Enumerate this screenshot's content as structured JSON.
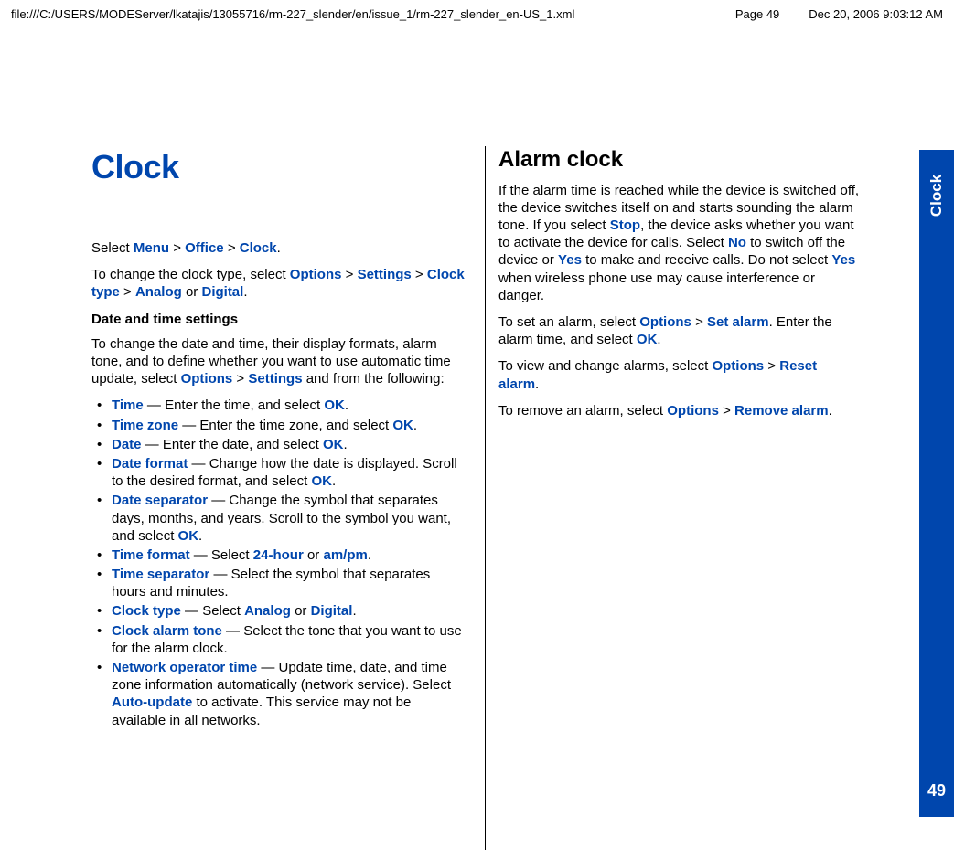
{
  "header": {
    "path": "file:///C:/USERS/MODEServer/lkatajis/13055716/rm-227_slender/en/issue_1/rm-227_slender_en-US_1.xml",
    "page_label": "Page 49",
    "timestamp": "Dec 20, 2006 9:03:12 AM"
  },
  "side_tab": {
    "label": "Clock",
    "page_number": "49"
  },
  "left": {
    "title": "Clock",
    "select_prefix": "Select ",
    "nav": {
      "menu": "Menu",
      "office": "Office",
      "clock": "Clock",
      "sep": " > "
    },
    "period": ".",
    "change_type_prefix": "To change the clock type, select ",
    "options": "Options",
    "settings": "Settings",
    "clock_type": "Clock type",
    "analog": "Analog",
    "digital": "Digital",
    "or": " or ",
    "subhead": "Date and time settings",
    "change_dt_prefix": "To change the date and time, their display formats, alarm tone, and to define whether you want to use automatic time update, select ",
    "change_dt_suffix": " and from the following:",
    "items": {
      "time": {
        "term": "Time",
        "suffix_pre": " — Enter the time, and select ",
        "ok": "OK",
        "suffix_post": "."
      },
      "time_zone": {
        "term": "Time zone",
        "suffix_pre": " — Enter the time zone, and select ",
        "ok": "OK",
        "suffix_post": "."
      },
      "date": {
        "term": "Date",
        "suffix_pre": " — Enter the date, and select ",
        "ok": "OK",
        "suffix_post": "."
      },
      "date_format": {
        "term": "Date format",
        "suffix_pre": " — Change how the date is displayed. Scroll to the desired format, and select ",
        "ok": "OK",
        "suffix_post": "."
      },
      "date_separator": {
        "term": "Date separator",
        "suffix_pre": " — Change the symbol that separates days, months, and years. Scroll to the symbol you want, and select ",
        "ok": "OK",
        "suffix_post": "."
      },
      "time_format": {
        "term": "Time format",
        "suffix_pre": " — Select ",
        "opt1": "24-hour",
        "or": " or ",
        "opt2": "am/pm",
        "suffix_post": "."
      },
      "time_separator": {
        "term": "Time separator",
        "suffix": " — Select the symbol that separates hours and minutes."
      },
      "clock_type": {
        "term": "Clock type",
        "suffix_pre": " — Select ",
        "opt1": "Analog",
        "or": " or ",
        "opt2": "Digital",
        "suffix_post": "."
      },
      "clock_alarm_tone": {
        "term": "Clock alarm tone",
        "suffix": " — Select the tone that you want to use for the alarm clock."
      },
      "network_operator_time": {
        "term": "Network operator time",
        "suffix_pre": " — Update time, date, and time zone information automatically (network service). Select ",
        "auto_update": "Auto-update",
        "suffix_post": " to activate. This service may not be available in all networks."
      }
    }
  },
  "right": {
    "heading": "Alarm clock",
    "p1_pre": "If the alarm time is reached while the device is switched off, the device switches itself on and starts sounding the alarm tone. If you select ",
    "stop": "Stop",
    "p1_mid1": ", the device asks whether you want to activate the device for calls. Select ",
    "no": "No",
    "p1_mid2": " to switch off the device or ",
    "yes": "Yes",
    "p1_mid3": " to make and receive calls. Do not select ",
    "p1_mid4": " when wireless phone use may cause interference or danger.",
    "p2_pre": "To set an alarm, select ",
    "options": "Options",
    "sep": " > ",
    "set_alarm": "Set alarm",
    "p2_mid": ". Enter the alarm time, and select ",
    "ok": "OK",
    "period": ".",
    "p3_pre": "To view and change alarms, select ",
    "reset_alarm": "Reset alarm",
    "p4_pre": "To remove an alarm, select ",
    "remove_alarm": "Remove alarm"
  }
}
